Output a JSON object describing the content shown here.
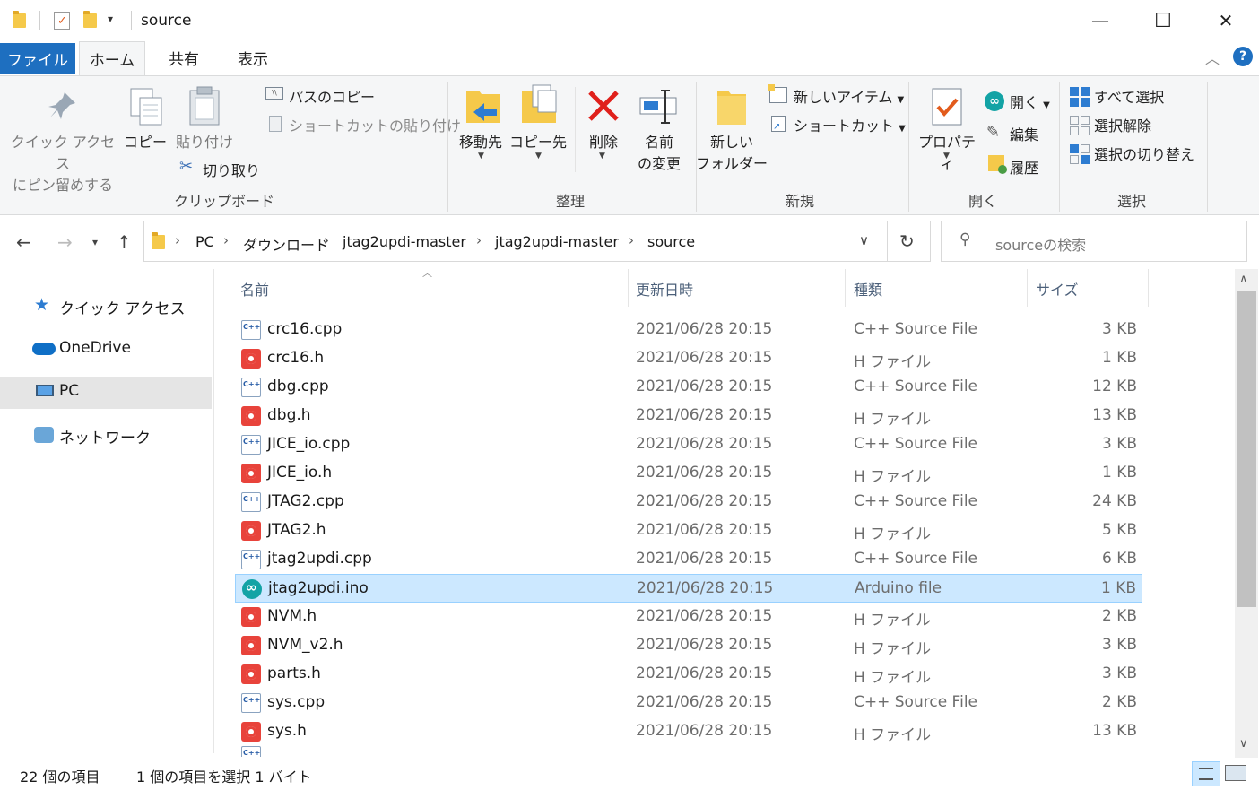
{
  "window": {
    "title": "source",
    "minimize": "—",
    "maximize": "☐",
    "close": "✕"
  },
  "tabs": [
    {
      "label": "ファイル"
    },
    {
      "label": "ホーム"
    },
    {
      "label": "共有"
    },
    {
      "label": "表示"
    }
  ],
  "ribbon": {
    "clipboard": {
      "pin_line1": "クイック アクセス",
      "pin_line2": "にピン留めする",
      "copy": "コピー",
      "paste": "貼り付け",
      "copy_path": "パスのコピー",
      "paste_shortcut": "ショートカットの貼り付け",
      "cut": "切り取り",
      "group": "クリップボード"
    },
    "organize": {
      "move_to": "移動先",
      "copy_to": "コピー先",
      "delete": "削除",
      "rename_line1": "名前",
      "rename_line2": "の変更",
      "group": "整理"
    },
    "new": {
      "new_folder_line1": "新しい",
      "new_folder_line2": "フォルダー",
      "new_item": "新しいアイテム",
      "shortcut": "ショートカット",
      "group": "新規"
    },
    "open": {
      "properties": "プロパティ",
      "open": "開く",
      "edit": "編集",
      "history": "履歴",
      "group": "開く"
    },
    "select": {
      "select_all": "すべて選択",
      "select_none": "選択解除",
      "invert": "選択の切り替え",
      "group": "選択"
    }
  },
  "address": {
    "crumbs": [
      "PC",
      "ダウンロード",
      "jtag2updi-master",
      "jtag2updi-master",
      "source"
    ],
    "search_placeholder": "sourceの検索"
  },
  "nav_pane": [
    {
      "label": "クイック アクセス",
      "icon": "star-icon"
    },
    {
      "label": "OneDrive",
      "icon": "cloud-icon"
    },
    {
      "label": "PC",
      "icon": "computer-icon"
    },
    {
      "label": "ネットワーク",
      "icon": "network-icon"
    }
  ],
  "columns": {
    "name": "名前",
    "date": "更新日時",
    "type": "種類",
    "size": "サイズ"
  },
  "files": [
    {
      "name": "crc16.cpp",
      "date": "2021/06/28 20:15",
      "type": "C++ Source File",
      "size": "3 KB",
      "kind": "cpp"
    },
    {
      "name": "crc16.h",
      "date": "2021/06/28 20:15",
      "type": "H ファイル",
      "size": "1 KB",
      "kind": "h"
    },
    {
      "name": "dbg.cpp",
      "date": "2021/06/28 20:15",
      "type": "C++ Source File",
      "size": "12 KB",
      "kind": "cpp"
    },
    {
      "name": "dbg.h",
      "date": "2021/06/28 20:15",
      "type": "H ファイル",
      "size": "13 KB",
      "kind": "h"
    },
    {
      "name": "JICE_io.cpp",
      "date": "2021/06/28 20:15",
      "type": "C++ Source File",
      "size": "3 KB",
      "kind": "cpp"
    },
    {
      "name": "JICE_io.h",
      "date": "2021/06/28 20:15",
      "type": "H ファイル",
      "size": "1 KB",
      "kind": "h"
    },
    {
      "name": "JTAG2.cpp",
      "date": "2021/06/28 20:15",
      "type": "C++ Source File",
      "size": "24 KB",
      "kind": "cpp"
    },
    {
      "name": "JTAG2.h",
      "date": "2021/06/28 20:15",
      "type": "H ファイル",
      "size": "5 KB",
      "kind": "h"
    },
    {
      "name": "jtag2updi.cpp",
      "date": "2021/06/28 20:15",
      "type": "C++ Source File",
      "size": "6 KB",
      "kind": "cpp"
    },
    {
      "name": "jtag2updi.ino",
      "date": "2021/06/28 20:15",
      "type": "Arduino file",
      "size": "1 KB",
      "kind": "ino",
      "selected": true
    },
    {
      "name": "NVM.h",
      "date": "2021/06/28 20:15",
      "type": "H ファイル",
      "size": "2 KB",
      "kind": "h"
    },
    {
      "name": "NVM_v2.h",
      "date": "2021/06/28 20:15",
      "type": "H ファイル",
      "size": "3 KB",
      "kind": "h"
    },
    {
      "name": "parts.h",
      "date": "2021/06/28 20:15",
      "type": "H ファイル",
      "size": "3 KB",
      "kind": "h"
    },
    {
      "name": "sys.cpp",
      "date": "2021/06/28 20:15",
      "type": "C++ Source File",
      "size": "2 KB",
      "kind": "cpp"
    },
    {
      "name": "sys.h",
      "date": "2021/06/28 20:15",
      "type": "H ファイル",
      "size": "13 KB",
      "kind": "h"
    }
  ],
  "status": {
    "count": "22 個の項目",
    "selection": "1 個の項目を選択  1 バイト"
  },
  "colors": {
    "accent": "#1e6fc0",
    "selection": "#cce8ff",
    "selection_border": "#99d1ff"
  }
}
